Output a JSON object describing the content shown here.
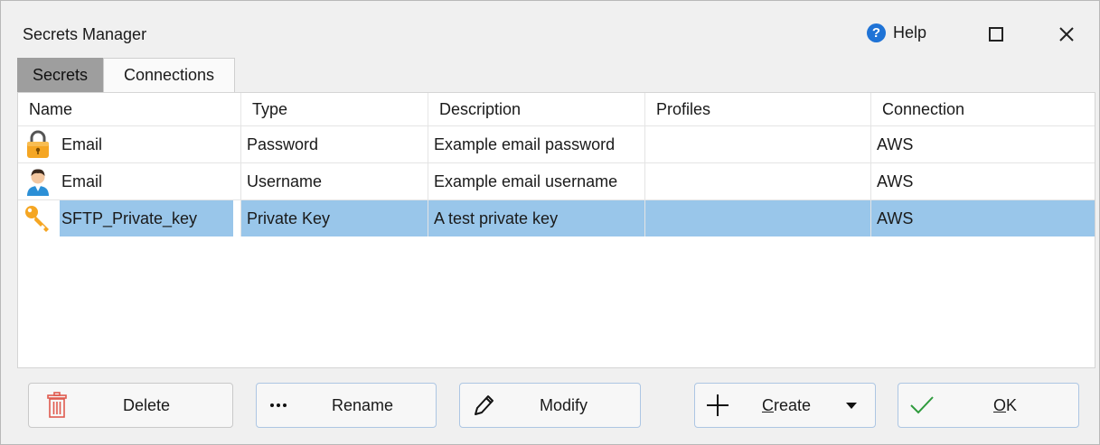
{
  "window": {
    "title": "Secrets Manager",
    "help_label": "Help"
  },
  "tabs": [
    {
      "label": "Secrets",
      "active": true
    },
    {
      "label": "Connections",
      "active": false
    }
  ],
  "table": {
    "columns": [
      "Name",
      "Type",
      "Description",
      "Profiles",
      "Connection"
    ],
    "rows": [
      {
        "icon": "lock-icon",
        "name": "Email",
        "type": "Password",
        "description": "Example email password",
        "profiles": "",
        "connection": "AWS",
        "selected": false
      },
      {
        "icon": "user-icon",
        "name": "Email",
        "type": "Username",
        "description": "Example email username",
        "profiles": "",
        "connection": "AWS",
        "selected": false
      },
      {
        "icon": "key-icon",
        "name": "SFTP_Private_key",
        "type": "Private Key",
        "description": "A test private key",
        "profiles": "",
        "connection": "AWS",
        "selected": true
      }
    ]
  },
  "buttons": {
    "delete": "Delete",
    "rename": "Rename",
    "modify": "Modify",
    "create_first": "C",
    "create_rest": "reate",
    "ok_first": "O",
    "ok_rest": "K"
  },
  "colors": {
    "selection": "#99c6ea",
    "accent": "#1f73d6",
    "delete_icon": "#e05a4e",
    "ok_check": "#2e9a3c"
  }
}
